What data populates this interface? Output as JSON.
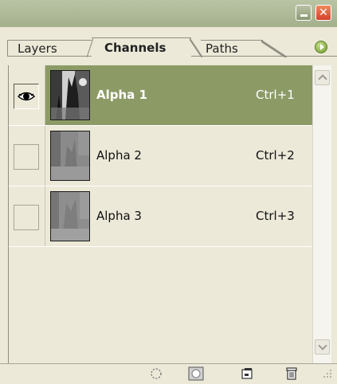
{
  "tabs": [
    {
      "label": "Layers"
    },
    {
      "label": "Channels"
    },
    {
      "label": "Paths"
    }
  ],
  "channels": [
    {
      "name": "Alpha 1",
      "shortcut": "Ctrl+1",
      "visible": true,
      "selected": true
    },
    {
      "name": "Alpha 2",
      "shortcut": "Ctrl+2",
      "visible": false,
      "selected": false
    },
    {
      "name": "Alpha 3",
      "shortcut": "Ctrl+3",
      "visible": false,
      "selected": false
    }
  ],
  "icons": {
    "minimize": "minimize-icon",
    "close": "close-icon",
    "panel_menu": "panel-menu-arrow-icon",
    "eye": "eye-icon",
    "load_selection": "load-channel-as-selection-icon",
    "save_selection": "save-selection-as-channel-icon",
    "new_channel": "new-channel-icon",
    "delete_channel": "trash-icon"
  },
  "colors": {
    "selected_row": "#8c9b66",
    "panel_bg": "#ece9d8",
    "close_button": "#d5402b"
  }
}
